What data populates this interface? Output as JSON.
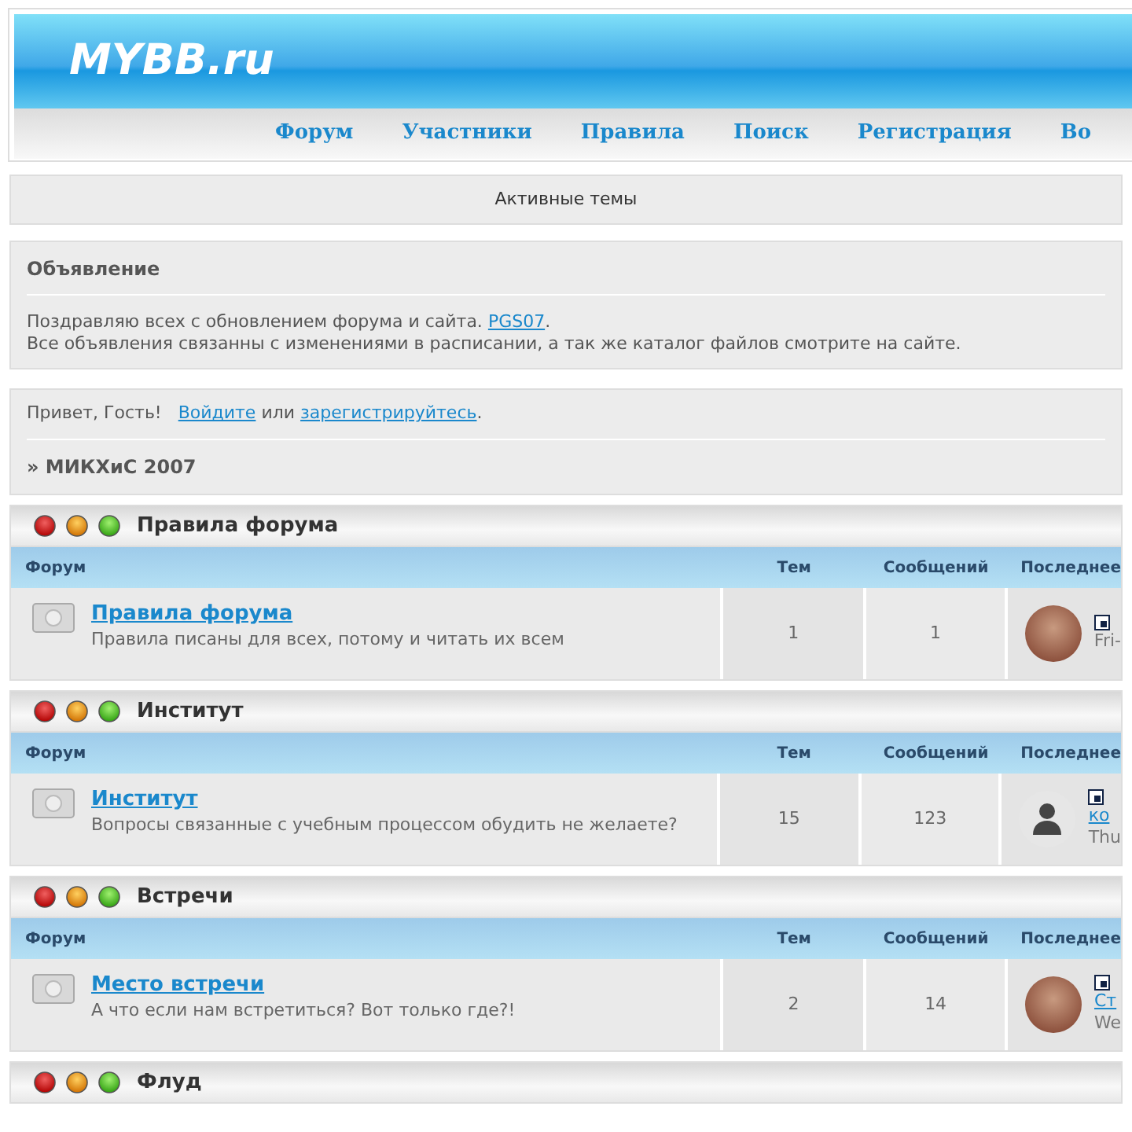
{
  "header": {
    "logo": "MYBB.ru",
    "nav": [
      {
        "label": "Форум"
      },
      {
        "label": "Участники"
      },
      {
        "label": "Правила"
      },
      {
        "label": "Поиск"
      },
      {
        "label": "Регистрация"
      },
      {
        "label": "Во"
      }
    ]
  },
  "active_topics": "Активные темы",
  "announcement": {
    "title": "Объявление",
    "line_1": "Поздравляю всех с обновлением форума и сайта. ",
    "link": "PGS07",
    "line_1_end": ".",
    "line_2": "Все объявления связанны с изменениями в расписании, а так же каталог файлов смотрите на сайте."
  },
  "welcome": {
    "greeting": "Привет, Гость!",
    "login_link": "Войдите",
    "or": "или",
    "register_link": "зарегистрируйтесь",
    "end": ".",
    "breadcrumb": "» МИКХиС 2007"
  },
  "categories": [
    {
      "title": "Правила форума",
      "columns": [
        "Форум",
        "Тем",
        "Сообщений",
        "Последнее"
      ],
      "forums": [
        {
          "name": "Правила форума",
          "description": "Правила писаны для всех, потому и читать их всем",
          "topics": "1",
          "posts": "1",
          "last_post": {
            "kind": "photo",
            "date": "Fri-"
          }
        }
      ]
    },
    {
      "title": "Институт",
      "columns": [
        "Форум",
        "Тем",
        "Сообщений",
        "Последнее"
      ],
      "forums": [
        {
          "name": "Институт",
          "description": "Вопросы связанные с учебным процессом обудить не желаете?",
          "topics": "15",
          "posts": "123",
          "last_post": {
            "kind": "silhouette",
            "link": "ко",
            "date": "Thu"
          }
        }
      ]
    },
    {
      "title": "Встречи",
      "columns": [
        "Форум",
        "Тем",
        "Сообщений",
        "Последнее"
      ],
      "forums": [
        {
          "name": "Место встречи",
          "description": "А что если нам встретиться? Вот только где?!",
          "topics": "2",
          "posts": "14",
          "last_post": {
            "kind": "photo",
            "link": "Ст",
            "date": "We"
          }
        }
      ]
    },
    {
      "title": "Флуд"
    }
  ]
}
